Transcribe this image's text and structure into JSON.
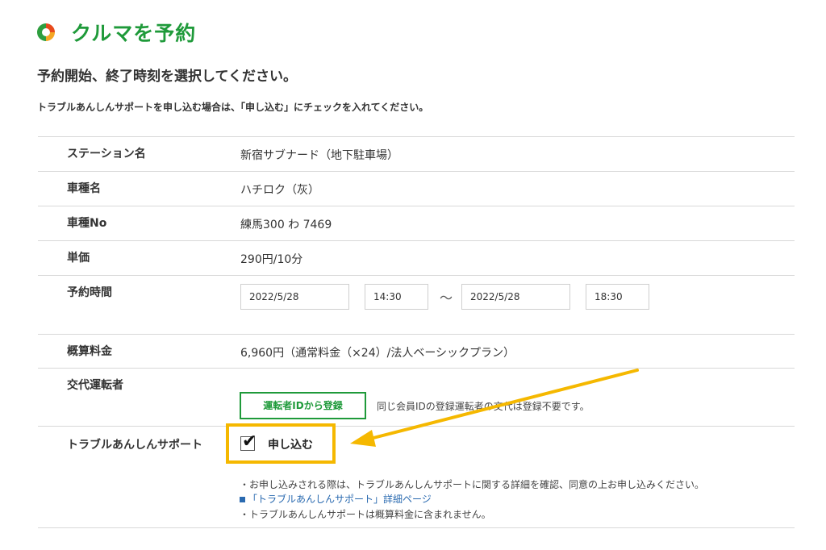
{
  "header": {
    "title": "クルマを予約",
    "logo_icon": "app-logo-icon"
  },
  "subtitle": "予約開始、終了時刻を選択してください。",
  "notice": "トラブルあんしんサポートを申し込む場合は、「申し込む」にチェックを入れてください。",
  "rows": {
    "station": {
      "label": "ステーション名",
      "value": "新宿サブナード（地下駐車場）"
    },
    "car_type": {
      "label": "車種名",
      "value": "ハチロク（灰）"
    },
    "car_no": {
      "label": "車種No",
      "value": "練馬300 わ 7469"
    },
    "price": {
      "label": "単価",
      "value": "290円/10分"
    },
    "time": {
      "label": "予約時間",
      "start_date": "2022/5/28",
      "start_time": "14:30",
      "separator": "〜",
      "end_date": "2022/5/28",
      "end_time": "18:30"
    },
    "estimate": {
      "label": "概算料金",
      "value": "6,960円（通常料金（×24）/法人ベーシックプラン）"
    },
    "driver": {
      "label": "交代運転者",
      "button_label": "運転者IDから登録",
      "note": "同じ会員IDの登録運転者の交代は登録不要です。"
    },
    "support": {
      "label": "トラブルあんしんサポート",
      "checkbox_label": "申し込む",
      "checked": true,
      "check_mark": "✔",
      "note1": "・お申し込みされる際は、トラブルあんしんサポートに関する詳細を確認、同意の上お申し込みください。",
      "link_text": "「トラブルあんしんサポート」詳細ページ",
      "note2": "・トラブルあんしんサポートは概算料金に含まれません。"
    }
  },
  "colors": {
    "brand_green": "#1f9a3a",
    "highlight": "#f5b800",
    "link": "#2a6ab0"
  }
}
